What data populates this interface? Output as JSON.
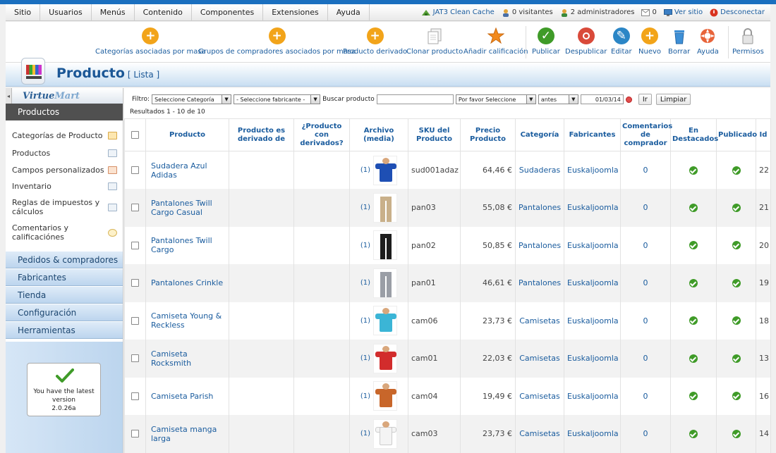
{
  "menu": [
    "Sitio",
    "Usuarios",
    "Menús",
    "Contenido",
    "Componentes",
    "Extensiones",
    "Ayuda"
  ],
  "status": {
    "cache": "JAT3 Clean Cache",
    "visitors": "0 visitantes",
    "admins": "2 administradores",
    "messages": "0",
    "view_site": "Ver sitio",
    "logout": "Desconectar"
  },
  "toolbar": {
    "cat_masa": "Categorías asociadas por masa",
    "grupos_masa": "Grupos de compradores asociados por masa",
    "derivado": "Producto derivado",
    "clonar": "Clonar producto",
    "calificacion": "Añadir calificación",
    "publicar": "Publicar",
    "despublicar": "Despublicar",
    "editar": "Editar",
    "nuevo": "Nuevo",
    "borrar": "Borrar",
    "ayuda": "Ayuda",
    "permisos": "Permisos"
  },
  "colors": {
    "add": "#f2a41a",
    "publish": "#3f9b28",
    "unpublish": "#d94a3a",
    "edit": "#2b86c6",
    "delete": "#3d8fd6",
    "help": "#e8643a",
    "rating": "#f28a1e"
  },
  "header": {
    "title": "Producto",
    "subtitle": "[ Lista ]"
  },
  "sidebar": {
    "logo_a": "Virtue",
    "logo_b": "Mart",
    "active": "Productos",
    "items": [
      "Categorías de Producto",
      "Productos",
      "Campos personalizados",
      "Inventario",
      "Reglas de impuestos y cálculos",
      "Comentarios y calificaciónes"
    ],
    "sections": [
      "Pedidos & compradores",
      "Fabricantes",
      "Tienda",
      "Configuración",
      "Herramientas"
    ],
    "version_line1": "You have the latest",
    "version_line2": "version",
    "version_number": "2.0.26a"
  },
  "filter": {
    "label": "Filtro:",
    "category": "Seleccione Categoría",
    "manufacturer": "- Seleccione fabricante -",
    "search_label": "Buscar producto",
    "search_value": "",
    "select_please": "Por favor Seleccione",
    "when": "antes",
    "date": "01/03/14",
    "go": "Ir",
    "clear": "Limpiar"
  },
  "results": "Resultados 1 - 10 de 10",
  "table": {
    "headers": [
      "",
      "Producto",
      "Producto es derivado de",
      "¿Producto con derivados?",
      "Archivo (media)",
      "SKU del Producto",
      "Precio Producto",
      "Categoría",
      "Fabricantes",
      "Comentarios de comprador",
      "En Destacados",
      "Publicado",
      "Id"
    ],
    "rows": [
      {
        "name": "Sudadera Azul Adidas",
        "media": "(1)",
        "sku": "sud001adaz",
        "price": "64,46 €",
        "category": "Sudaderas",
        "maker": "Euskaljoomla",
        "reviews": "0",
        "id": "22",
        "kind": "shirt",
        "color": "#1e4fb4",
        "featured": true,
        "published": true
      },
      {
        "name": "Pantalones Twill Cargo Casual",
        "media": "(1)",
        "sku": "pan03",
        "price": "55,08 €",
        "category": "Pantalones",
        "maker": "Euskaljoomla",
        "reviews": "0",
        "id": "21",
        "kind": "pants",
        "color": "#c9b08a",
        "featured": true,
        "published": true
      },
      {
        "name": "Pantalones Twill Cargo",
        "media": "(1)",
        "sku": "pan02",
        "price": "50,85 €",
        "category": "Pantalones",
        "maker": "Euskaljoomla",
        "reviews": "0",
        "id": "20",
        "kind": "pants",
        "color": "#1d1d1d",
        "featured": true,
        "published": true
      },
      {
        "name": "Pantalones Crinkle",
        "media": "(1)",
        "sku": "pan01",
        "price": "46,61 €",
        "category": "Pantalones",
        "maker": "Euskaljoomla",
        "reviews": "0",
        "id": "19",
        "kind": "pants",
        "color": "#9a9ea6",
        "featured": true,
        "published": true
      },
      {
        "name": "Camiseta Young & Reckless",
        "media": "(1)",
        "sku": "cam06",
        "price": "23,73 €",
        "category": "Camisetas",
        "maker": "Euskaljoomla",
        "reviews": "0",
        "id": "18",
        "kind": "shirt",
        "color": "#3bb5d6",
        "featured": true,
        "published": true
      },
      {
        "name": "Camiseta Rocksmith",
        "media": "(1)",
        "sku": "cam01",
        "price": "22,03 €",
        "category": "Camisetas",
        "maker": "Euskaljoomla",
        "reviews": "0",
        "id": "13",
        "kind": "shirt",
        "color": "#d22c2c",
        "featured": true,
        "published": true
      },
      {
        "name": "Camiseta Parish",
        "media": "(1)",
        "sku": "cam04",
        "price": "19,49 €",
        "category": "Camisetas",
        "maker": "Euskaljoomla",
        "reviews": "0",
        "id": "16",
        "kind": "shirt",
        "color": "#c8662a",
        "featured": true,
        "published": true
      },
      {
        "name": "Camiseta manga larga",
        "media": "(1)",
        "sku": "cam03",
        "price": "23,73 €",
        "category": "Camisetas",
        "maker": "Euskaljoomla",
        "reviews": "0",
        "id": "14",
        "kind": "shirt",
        "color": "#f4f4f4",
        "featured": true,
        "published": true
      }
    ]
  }
}
